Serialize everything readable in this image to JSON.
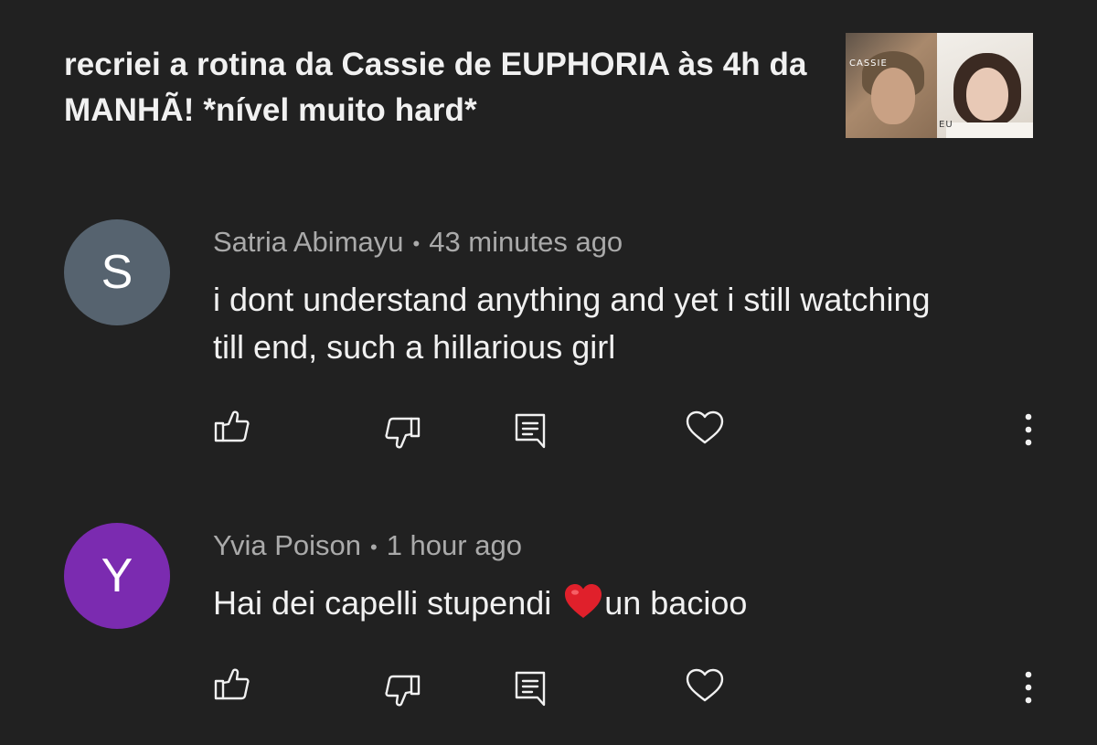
{
  "video": {
    "title": "recriei a rotina da Cassie de EUPHORIA às 4h da MANHÃ! *nível muito hard*",
    "thumbnail_labels": {
      "left": "CASSIE",
      "right": "EU"
    }
  },
  "comments": [
    {
      "avatar_letter": "S",
      "avatar_color": "#56636f",
      "author": "Satria Abimayu",
      "separator": "•",
      "time": "43 minutes ago",
      "text": "i dont understand anything and yet i still watching till end, such a hillarious girl",
      "text_suffix": ""
    },
    {
      "avatar_letter": "Y",
      "avatar_color": "#7b2bb0",
      "author": "Yvia Poison",
      "separator": "•",
      "time": "1 hour ago",
      "text": "Hai dei capelli stupendi ",
      "text_suffix": "un bacioo"
    }
  ],
  "icons": {
    "like": "thumbs-up-icon",
    "dislike": "thumbs-down-icon",
    "reply": "reply-comment-icon",
    "heart": "heart-outline-icon",
    "more": "more-vertical-icon",
    "emoji": "red-heart-emoji"
  },
  "colors": {
    "background": "#212121",
    "primary_text": "#f1f1f1",
    "secondary_text": "#aaaaaa"
  }
}
